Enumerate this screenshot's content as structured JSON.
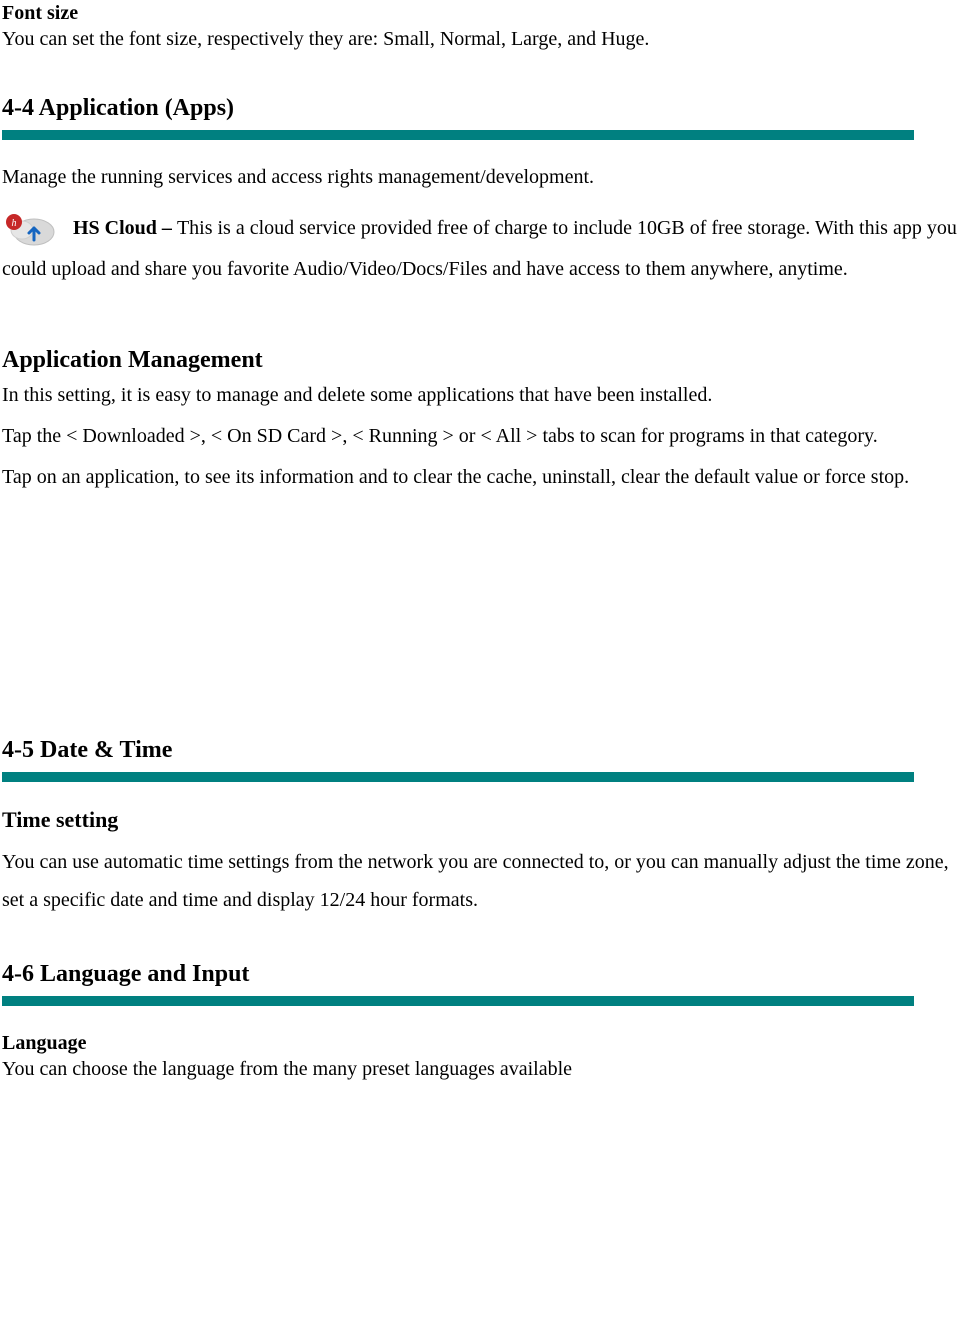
{
  "font_size": {
    "title": "Font size",
    "body": "You can set the font size, respectively they are: Small, Normal, Large, and Huge."
  },
  "section_4_4": {
    "heading": "4-4 Application (Apps)",
    "intro": "Manage the running services and access rights management/development.",
    "hs_cloud_label": "HS Cloud – ",
    "hs_cloud_body": "This is a cloud service provided free of charge to include 10GB of free storage. With this app you could upload and share you favorite Audio/Video/Docs/Files and have access to them anywhere, anytime."
  },
  "app_mgmt": {
    "heading": "Application Management",
    "p1": "In this setting, it is easy to manage and delete some applications that have been installed.",
    "p2": "Tap the < Downloaded >, < On SD Card >, < Running > or < All > tabs to scan for programs in that category.",
    "p3": "Tap on an application, to see its information and to clear the cache, uninstall, clear the default value or force stop."
  },
  "section_4_5": {
    "heading": "4-5 Date & Time",
    "sub": "Time setting",
    "body": "You can use automatic time settings from the network you are connected to, or you can manually adjust the time zone, set a specific date and time and display 12/24 hour formats."
  },
  "section_4_6": {
    "heading": "4-6 Language and Input",
    "sub": "Language",
    "body": "You can choose the language from the many preset languages available"
  }
}
